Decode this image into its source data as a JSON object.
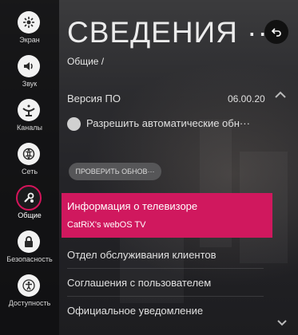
{
  "header": {
    "title": "СВЕДЕНИЯ ···",
    "breadcrumb": "Общие /"
  },
  "sidebar": {
    "items": [
      {
        "label": "Экран",
        "icon": "screen-icon"
      },
      {
        "label": "Звук",
        "icon": "speaker-icon"
      },
      {
        "label": "Каналы",
        "icon": "antenna-icon"
      },
      {
        "label": "Сеть",
        "icon": "globe-icon"
      },
      {
        "label": "Общие",
        "icon": "general-settings-icon",
        "active": true
      },
      {
        "label": "Безопасность",
        "icon": "lock-icon"
      },
      {
        "label": "Доступность",
        "icon": "accessibility-icon"
      }
    ]
  },
  "settings": {
    "software_version": {
      "label": "Версия ПО",
      "value": "06.00.20"
    },
    "auto_update": {
      "label": "Разрешить автоматические обн···"
    },
    "check_updates_button": "ПРОВЕРИТЬ ОБНОВ···",
    "tv_info": {
      "label": "Информация о телевизоре",
      "sub": "CatRiX's webOS TV"
    },
    "customer_service": "Отдел обслуживания клиентов",
    "user_agreements": "Соглашения с пользователем",
    "official_notice": "Официальное уведомление"
  },
  "colors": {
    "accent": "#d0185e"
  }
}
